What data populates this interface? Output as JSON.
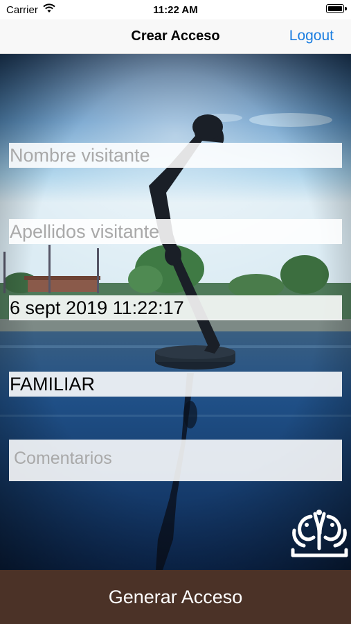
{
  "status_bar": {
    "carrier": "Carrier",
    "time": "11:22 AM"
  },
  "nav": {
    "title": "Crear Acceso",
    "logout_label": "Logout"
  },
  "form": {
    "nombre_placeholder": "Nombre visitante",
    "apellidos_placeholder": "Apellidos visitante",
    "fecha_value": "6 sept 2019 11:22:17",
    "tipo_value": "FAMILIAR",
    "comentarios_placeholder": "Comentarios"
  },
  "actions": {
    "generate_label": "Generar Acceso"
  },
  "icons": {
    "wifi": "wifi-icon",
    "battery": "battery-icon",
    "logo": "brand-logo-icon"
  },
  "colors": {
    "accent": "#1a7de0",
    "button_bg": "#4b3227",
    "nav_bg": "#f8f8f8"
  }
}
